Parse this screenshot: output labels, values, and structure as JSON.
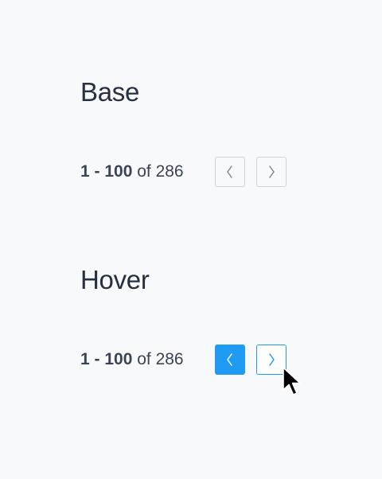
{
  "base": {
    "title": "Base",
    "range_bold": "1 - 100",
    "range_rest": " of 286",
    "prev_icon": "chevron-left-icon",
    "next_icon": "chevron-right-icon"
  },
  "hover": {
    "title": "Hover",
    "range_bold": "1 - 100",
    "range_rest": " of 286",
    "prev_icon": "chevron-left-icon",
    "next_icon": "chevron-right-icon"
  },
  "colors": {
    "background": "#f8f9fa",
    "text": "#263042",
    "border": "#cfd3d9",
    "accent": "#1f9bf3"
  },
  "cursor_icon": "mouse-pointer-icon"
}
